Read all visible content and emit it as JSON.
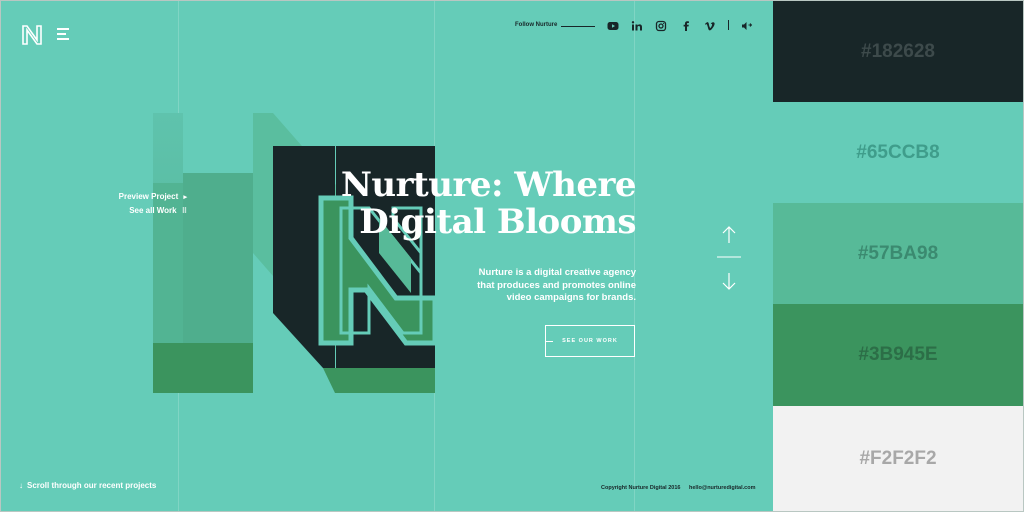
{
  "header": {
    "follow_label": "Follow Nurture",
    "social_icons": [
      "youtube-icon",
      "linkedin-icon",
      "instagram-icon",
      "facebook-icon",
      "vimeo-icon",
      "sound-icon"
    ]
  },
  "side": {
    "preview_label": "Preview Project",
    "see_all_label": "See all Work"
  },
  "hero": {
    "headline_line1": "Nurture: Where",
    "headline_line2": "Digital Blooms",
    "description": "Nurture is a digital creative agency that produces and promotes online video campaigns for brands.",
    "cta_label": "SEE OUR WORK"
  },
  "footer": {
    "scroll_label": "Scroll through our recent projects",
    "copyright": "Copyright Nurture Digital 2016",
    "email": "hello@nurturedigital.com"
  },
  "palette": [
    {
      "hex": "#182628",
      "text_color": "#3d4a4b"
    },
    {
      "hex": "#65CCB8",
      "text_color": "#3f9d8b"
    },
    {
      "hex": "#57BA98",
      "text_color": "#3b8a70"
    },
    {
      "hex": "#3B945E",
      "text_color": "#2c6e47"
    },
    {
      "hex": "#F2F2F2",
      "text_color": "#a8a8a8"
    }
  ],
  "colors": {
    "background": "#65CCB8",
    "dark": "#182628",
    "green": "#3B945E",
    "mid": "#57BA98"
  }
}
